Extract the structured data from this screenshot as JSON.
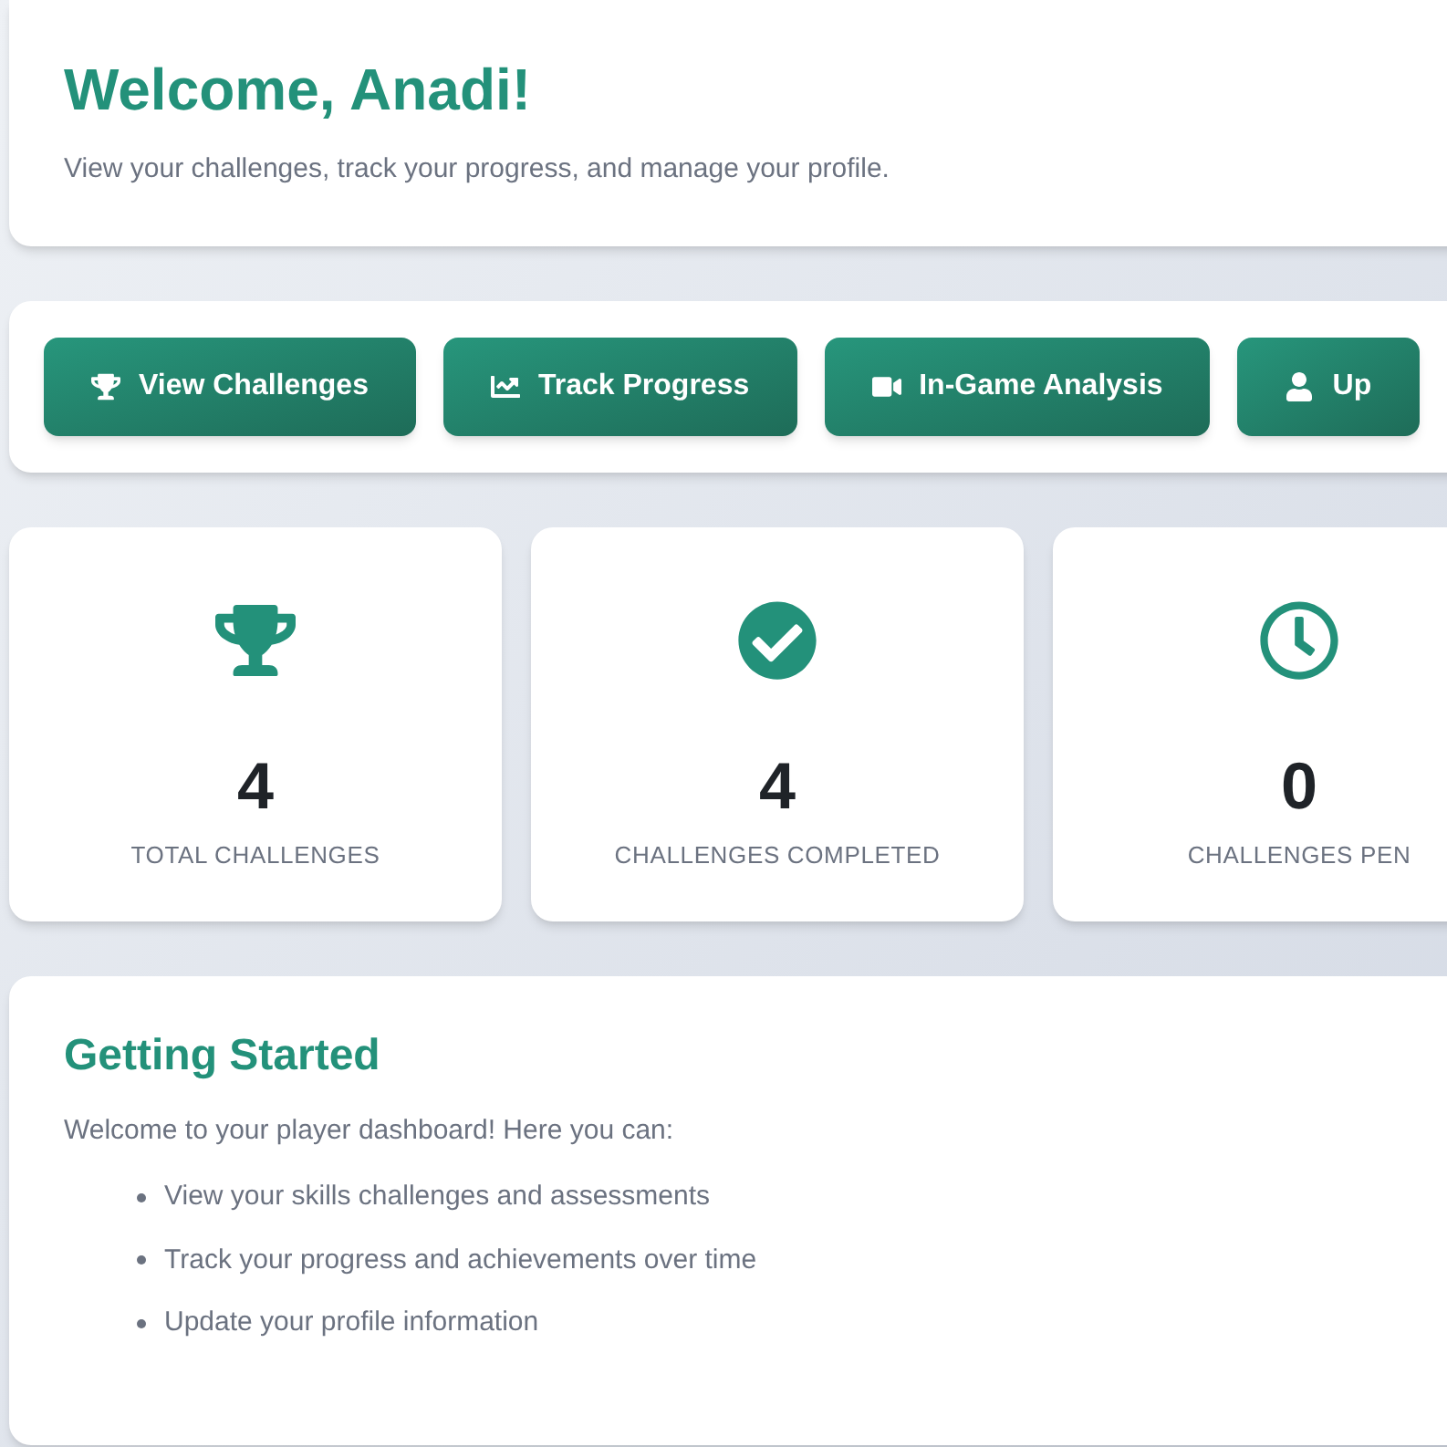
{
  "header": {
    "title": "Welcome, Anadi!",
    "subtitle": "View your challenges, track your progress, and manage your profile."
  },
  "actions": [
    {
      "kind": "trophy",
      "label": "View Challenges"
    },
    {
      "kind": "chart",
      "label": "Track Progress"
    },
    {
      "kind": "video",
      "label": "In-Game Analysis"
    },
    {
      "kind": "user",
      "label": "Up"
    }
  ],
  "stats": [
    {
      "kind": "trophy",
      "value": "4",
      "label": "TOTAL CHALLENGES"
    },
    {
      "kind": "check",
      "value": "4",
      "label": "CHALLENGES COMPLETED"
    },
    {
      "kind": "clock",
      "value": "0",
      "label": "CHALLENGES PEN"
    }
  ],
  "getting_started": {
    "title": "Getting Started",
    "intro": "Welcome to your player dashboard! Here you can:",
    "items": [
      "View your skills challenges and assessments",
      "Track your progress and achievements over time",
      "Update your profile information"
    ]
  }
}
